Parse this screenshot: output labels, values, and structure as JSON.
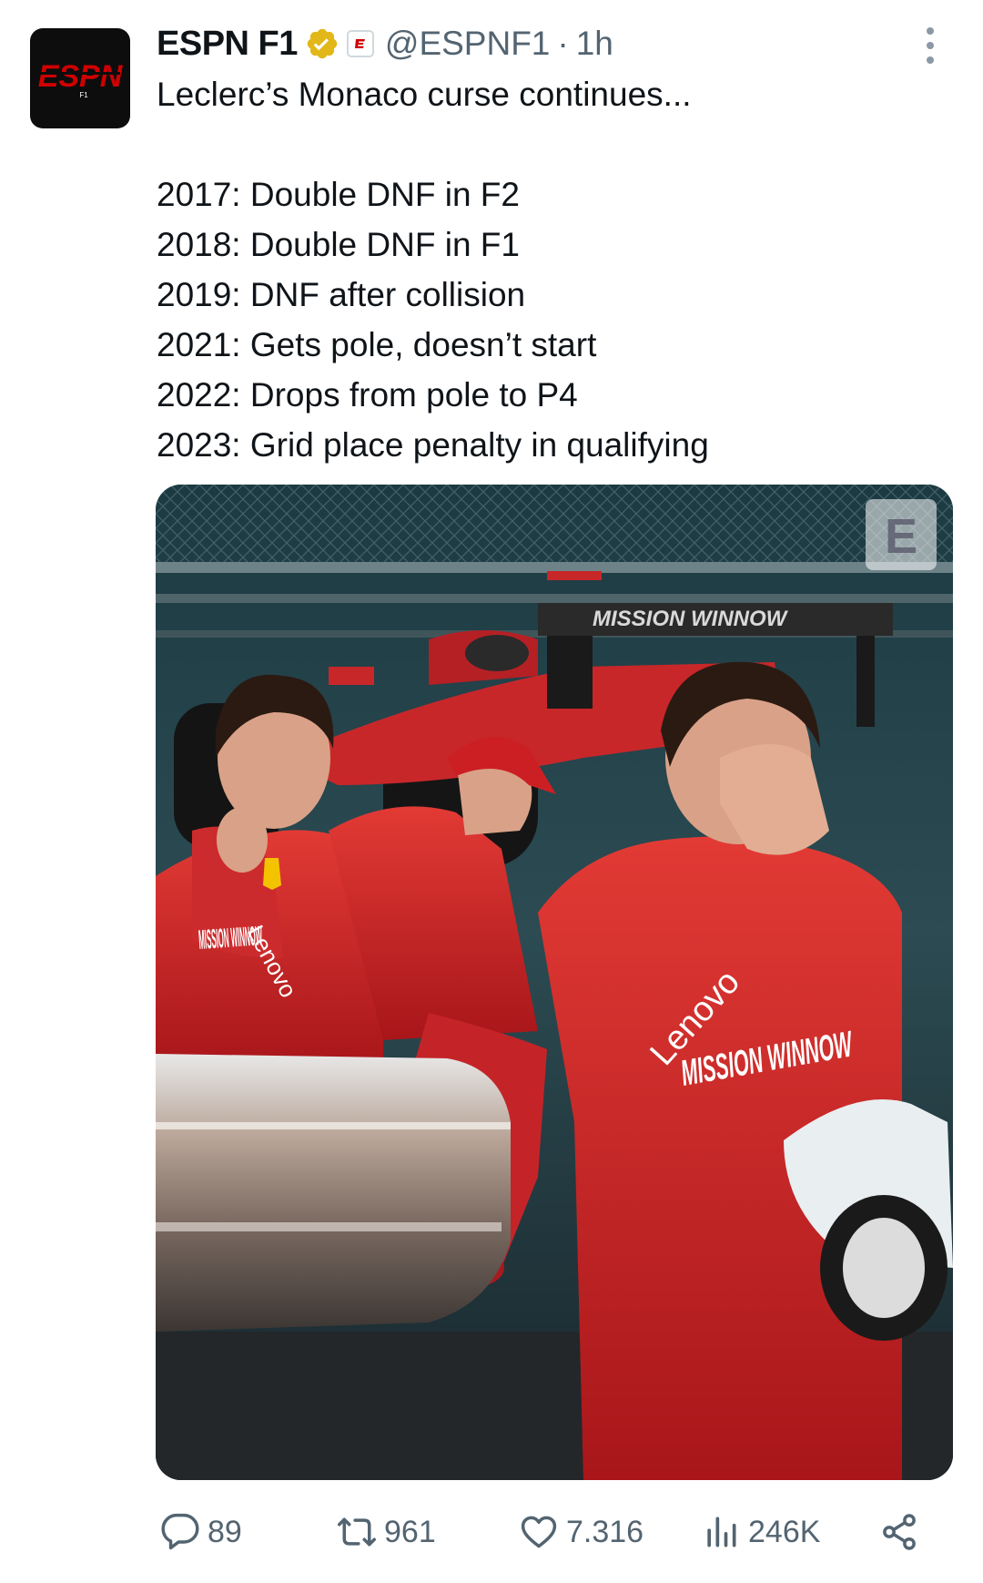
{
  "author": {
    "name": "ESPN F1",
    "handle": "@ESPNF1",
    "separator": "·",
    "time": "1h",
    "avatar_text": "ESPN",
    "avatar_sub": "F1"
  },
  "tweet": {
    "lines": [
      "Leclerc’s Monaco curse continues...",
      "",
      "2017: Double DNF in F2",
      "2018: Double DNF in F1",
      "2019: DNF after collision",
      "2021: Gets pole, doesn’t start",
      "2022: Drops from pole to P4",
      "2023: Grid place penalty in qualifying"
    ]
  },
  "media": {
    "wing_text": "MISSION WINNOW",
    "suit_sponsor": "Lenovo",
    "suit_text": "MISSION WINNOW",
    "watermark": "E"
  },
  "actions": {
    "replies": "89",
    "retweets": "961",
    "likes": "7.316",
    "views": "246K"
  },
  "icons": {
    "verified": "verified-badge-icon",
    "affiliate": "espn-affiliate-icon",
    "more": "more-options-icon",
    "reply": "reply-icon",
    "retweet": "retweet-icon",
    "like": "heart-icon",
    "views": "views-icon",
    "share": "share-icon"
  },
  "colors": {
    "brand_red": "#d00000",
    "verified_gold": "#e2b719",
    "text": "#0f1419",
    "muted": "#536471",
    "ferrari_red": "#d8262b"
  }
}
